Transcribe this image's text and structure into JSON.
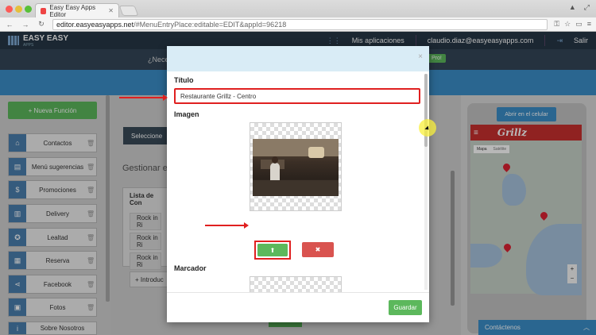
{
  "browser": {
    "tab_title": "Easy Easy Apps Editor",
    "url_host": "editor.easyeasyapps.net",
    "url_rest": "/#MenuEntryPlace:editable=EDIT&appId=96218"
  },
  "header": {
    "logo_text": "EASY EASY",
    "logo_sub": "APPS",
    "my_apps": "Mis aplicaciones",
    "user_email": "claudio.diaz@easyeasyapps.com",
    "logout": "Salir"
  },
  "subheader": {
    "question": "¿Nece",
    "pro_badge": "Pro!"
  },
  "sidebar": {
    "new_function": "+ Nueva Función",
    "items": [
      {
        "label": "Contactos",
        "icon": "home-icon"
      },
      {
        "label": "Menú sugerencias",
        "icon": "book-icon"
      },
      {
        "label": "Promociones",
        "icon": "cash-icon"
      },
      {
        "label": "Delivery",
        "icon": "clipboard-icon"
      },
      {
        "label": "Lealtad",
        "icon": "award-icon"
      },
      {
        "label": "Reserva",
        "icon": "calendar-icon"
      },
      {
        "label": "Facebook",
        "icon": "share-icon"
      },
      {
        "label": "Fotos",
        "icon": "photo-icon"
      },
      {
        "label": "Sobre Nosotros",
        "icon": "info-icon"
      }
    ]
  },
  "main": {
    "select_button": "Seleccione",
    "manage_heading": "Gestionar e",
    "list_header": "Lista de Con",
    "list_rows": [
      "Rock in Ri",
      "Rock in Ri",
      "Rock in Ri"
    ],
    "intro_button": "+ Introduc"
  },
  "preview": {
    "open_phone": "Abrir en el celular",
    "brand": "Grillz",
    "map_tab": "Mapa",
    "satellite_tab": "Satélite",
    "contact_bar": "Contáctenos"
  },
  "modal": {
    "title_label": "Título",
    "title_value": "Restaurante Grillz - Centro",
    "image_label": "Imagen",
    "marker_label": "Marcador",
    "save_button": "Guardar"
  },
  "colors": {
    "primary_blue": "#3b8ec8",
    "success_green": "#5cb85c",
    "danger_red": "#d9534f",
    "highlight_red": "#e02020",
    "header_dark": "#263746"
  }
}
